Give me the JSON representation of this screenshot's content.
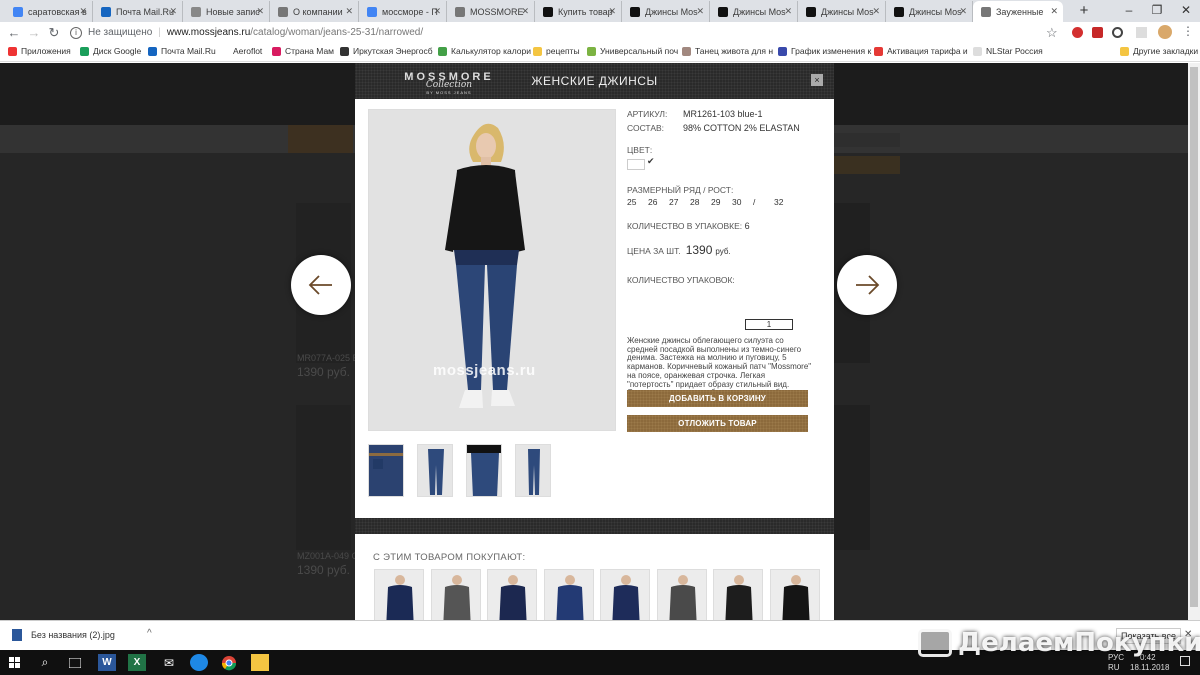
{
  "tabs": [
    {
      "title": "саратовская в",
      "icon": "google-favicon-icon"
    },
    {
      "title": "Почта Mail.Ru",
      "icon": "mail-favicon-icon"
    },
    {
      "title": "Новые запис",
      "icon": "notes-favicon-icon"
    },
    {
      "title": "О компании",
      "icon": "m-favicon-icon"
    },
    {
      "title": "мосcморе - П",
      "icon": "google-favicon-icon"
    },
    {
      "title": "MOSSMORE",
      "icon": "m-favicon-icon"
    },
    {
      "title": "Купить товар",
      "icon": "la-favicon-icon"
    },
    {
      "title": "Джинсы Mos",
      "icon": "la-favicon-icon"
    },
    {
      "title": "Джинсы Mos",
      "icon": "la-favicon-icon"
    },
    {
      "title": "Джинсы Mos",
      "icon": "la-favicon-icon"
    },
    {
      "title": "Джинсы Mos",
      "icon": "la-favicon-icon"
    },
    {
      "title": "Зауженные",
      "icon": "m-favicon-icon",
      "active": true
    }
  ],
  "toolbar": {
    "security": "Не защищено",
    "url_domain": "www.mossjeans.ru",
    "url_path": "/catalog/woman/jeans-25-31/narrowed/"
  },
  "bookmarks": [
    {
      "label": "Приложения",
      "color": "#e33"
    },
    {
      "label": "Диск Google",
      "color": "#1a9e5a"
    },
    {
      "label": "Почта Mail.Ru",
      "color": "#1565c0"
    },
    {
      "label": "Aeroflot",
      "color": "#fff"
    },
    {
      "label": "Страна Мам",
      "color": "#d81b60"
    },
    {
      "label": "Иркутская Энергосб",
      "color": "#333"
    },
    {
      "label": "Калькулятор калори",
      "color": "#43a047"
    },
    {
      "label": "рецепты",
      "color": "#f4c542"
    },
    {
      "label": "Универсальный поч",
      "color": "#7cb342"
    },
    {
      "label": "Танец живота для н",
      "color": "#a1887f"
    },
    {
      "label": "График изменения к",
      "color": "#3949ab"
    },
    {
      "label": "Активация тарифа и",
      "color": "#e53935"
    },
    {
      "label": "NLStar Россия",
      "color": "#ddd"
    },
    {
      "label": "Другие закладки",
      "color": "#f4c542"
    }
  ],
  "background": {
    "items": [
      {
        "sku": "MR077A-025 B",
        "price": "1390 руб."
      },
      {
        "sku": "MZ001A-049 O",
        "price": "1390 руб."
      }
    ]
  },
  "modal": {
    "logo_main": "MOSSMORE",
    "logo_script": "Collection",
    "logo_sub": "BY MOSS JEANS",
    "title": "ЖЕНСКИЕ ДЖИНСЫ",
    "close": "×",
    "article_label": "АРТИКУЛ:",
    "article_value": "MR1261-103 blue-1",
    "composition_label": "СОСТАВ:",
    "composition_value": "98% COTTON 2% ELASTAN",
    "color_label": "ЦВЕТ:",
    "size_label": "РАЗМЕРНЫЙ РЯД / РОСТ:",
    "sizes": [
      "25",
      "26",
      "27",
      "28",
      "29",
      "30",
      "/",
      "32"
    ],
    "pack_qty_label": "КОЛИЧЕСТВО В УПАКОВКЕ:",
    "pack_qty_value": "6",
    "price_label": "ЦЕНА ЗА ШТ.",
    "price_value": "1390",
    "price_unit": "руб.",
    "packs_label": "КОЛИЧЕСТВО УПАКОВОК:",
    "packs_value": "1",
    "description": "Женские джинсы облегающего силуэта со средней посадкой выполнены из темно-синего денима. Застежка на молнию и пуговицу, 5 карманов. Коричневый кожаный патч \"Mossmore\" на поясе, оранжевая строчка. Легкая \"потертость\" придает образу стильный вид. Отличная модель для базового гардероба.",
    "add_to_cart": "ДОБАВИТЬ В КОРЗИНУ",
    "postpone": "ОТЛОЖИТЬ ТОВАР",
    "watermark": "mossjeans.ru",
    "also_bought": "С ЭТИМ ТОВАРОМ ПОКУПАЮТ:"
  },
  "download": {
    "filename": "Без названия (2).jpg",
    "show_all": "Показать все"
  },
  "taskbar": {
    "lang": "RU",
    "lang2": "РУС",
    "time": "0:42",
    "date": "18.11.2018"
  },
  "watermark_corner": "ДелаемПокупки.Ру"
}
